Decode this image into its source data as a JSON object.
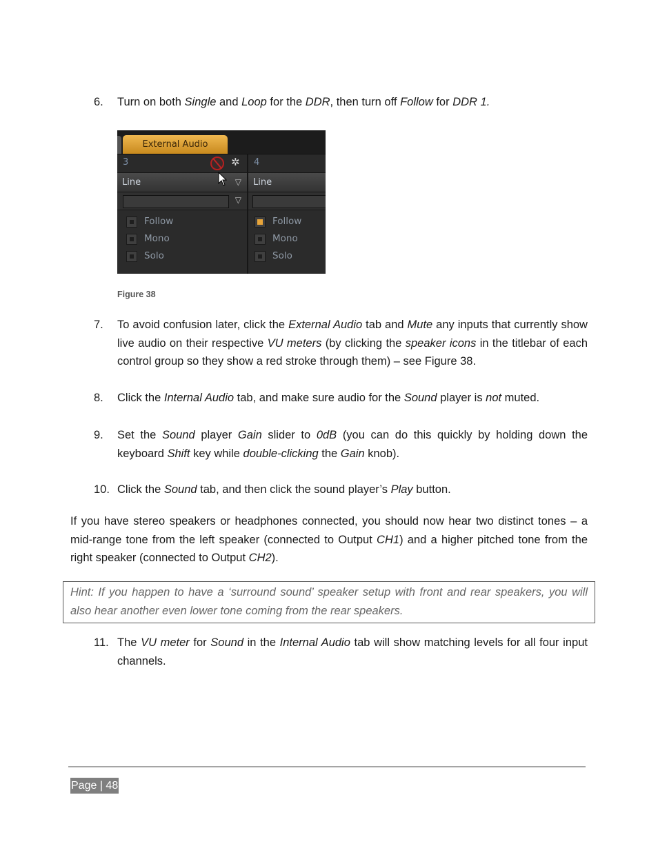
{
  "steps": [
    {
      "num": "6.",
      "segments": [
        {
          "t": "Turn on both "
        },
        {
          "t": "Single",
          "i": true
        },
        {
          "t": " and "
        },
        {
          "t": "Loop",
          "i": true
        },
        {
          "t": " for the "
        },
        {
          "t": "DDR",
          "i": true
        },
        {
          "t": ", then turn off "
        },
        {
          "t": "Follow",
          "i": true
        },
        {
          "t": " for "
        },
        {
          "t": "DDR 1.",
          "i": true
        }
      ]
    },
    {
      "num": "7.",
      "segments": [
        {
          "t": "To avoid confusion later, click the "
        },
        {
          "t": "External Audio",
          "i": true
        },
        {
          "t": " tab and "
        },
        {
          "t": "Mute",
          "i": true
        },
        {
          "t": " any inputs that currently show live audio on their respective "
        },
        {
          "t": "VU meters",
          "i": true
        },
        {
          "t": " (by clicking the "
        },
        {
          "t": "speaker icons",
          "i": true
        },
        {
          "t": " in the titlebar of each control group so they show a red stroke through them) – see Figure 38."
        }
      ]
    },
    {
      "num": "8.",
      "segments": [
        {
          "t": "Click the "
        },
        {
          "t": "Internal Audio",
          "i": true
        },
        {
          "t": " tab, and make sure audio for the "
        },
        {
          "t": "Sound",
          "i": true
        },
        {
          "t": " player is "
        },
        {
          "t": "not",
          "i": true
        },
        {
          "t": " muted."
        }
      ]
    },
    {
      "num": "9.",
      "segments": [
        {
          "t": "Set the "
        },
        {
          "t": "Sound",
          "i": true
        },
        {
          "t": " player "
        },
        {
          "t": "Gain",
          "i": true
        },
        {
          "t": " slider to "
        },
        {
          "t": "0dB",
          "i": true
        },
        {
          "t": " (you can do this quickly by holding down the keyboard "
        },
        {
          "t": "Shift",
          "i": true
        },
        {
          "t": " key while "
        },
        {
          "t": "double-clicking",
          "i": true
        },
        {
          "t": " the "
        },
        {
          "t": "Gain",
          "i": true
        },
        {
          "t": " knob)."
        }
      ]
    },
    {
      "num": "10.",
      "segments": [
        {
          "t": "Click the "
        },
        {
          "t": "Sound",
          "i": true
        },
        {
          "t": " tab, and then click the sound player’s "
        },
        {
          "t": "Play",
          "i": true
        },
        {
          "t": " button."
        }
      ]
    },
    {
      "num": "11.",
      "segments": [
        {
          "t": "The "
        },
        {
          "t": "VU meter",
          "i": true
        },
        {
          "t": " for "
        },
        {
          "t": "Sound",
          "i": true
        },
        {
          "t": " in the "
        },
        {
          "t": "Internal Audio",
          "i": true
        },
        {
          "t": " tab will show matching levels for all four input channels."
        }
      ]
    }
  ],
  "paragraph": [
    {
      "t": "If you have stereo speakers or headphones connected, you should now hear two distinct tones – a mid-range tone from the left speaker (connected to Output "
    },
    {
      "t": "CH1",
      "i": true
    },
    {
      "t": ") and a higher pitched tone from the right speaker (connected to Output "
    },
    {
      "t": "CH2",
      "i": true
    },
    {
      "t": ")."
    }
  ],
  "hint": "Hint: If you happen to have a ‘surround sound’ speaker setup with front and rear speakers, you will also hear another even lower tone coming from the rear speakers.",
  "figure": {
    "tab_label": "External Audio",
    "caption": "Figure 38",
    "channels": [
      {
        "number": "3",
        "source": "Line",
        "muted": true,
        "options": [
          {
            "label": "Follow",
            "checked": false
          },
          {
            "label": "Mono",
            "checked": false
          },
          {
            "label": "Solo",
            "checked": false
          }
        ]
      },
      {
        "number": "4",
        "source": "Line",
        "options": [
          {
            "label": "Follow",
            "checked": true
          },
          {
            "label": "Mono",
            "checked": false
          },
          {
            "label": "Solo",
            "checked": false
          }
        ]
      }
    ],
    "accent_color": "#e8a53a",
    "mute_color": "#b52020"
  },
  "footer": {
    "page_label": "Page | 48"
  }
}
